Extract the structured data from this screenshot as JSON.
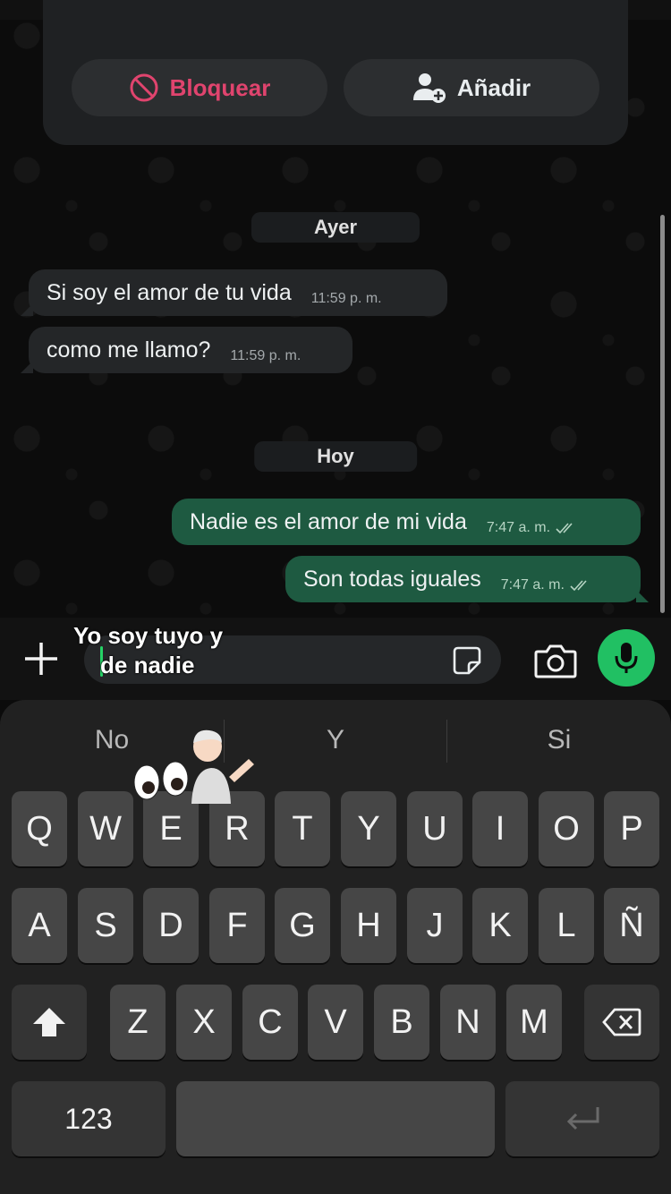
{
  "contact_card": {
    "block_label": "Bloquear",
    "add_label": "Añadir"
  },
  "chat": {
    "date_yesterday": "Ayer",
    "date_today": "Hoy",
    "messages": [
      {
        "direction": "incoming",
        "text": "Si soy el amor de tu vida",
        "time": "11:59 p. m."
      },
      {
        "direction": "incoming",
        "text": "como me llamo?",
        "time": "11:59 p. m."
      },
      {
        "direction": "outgoing",
        "text": "Nadie es el amor de mi vida",
        "time": "7:47 a. m.",
        "status": "read"
      },
      {
        "direction": "outgoing",
        "text": "Son todas iguales",
        "time": "7:47 a. m.",
        "status": "read"
      }
    ]
  },
  "composer": {
    "overlay_line1": "Yo soy tuyo y",
    "overlay_line2": "de nadie",
    "icons": [
      "plus-icon",
      "sticker-icon",
      "camera-icon",
      "mic-icon"
    ]
  },
  "keyboard": {
    "suggestions": [
      "No",
      "Y",
      "Si"
    ],
    "emoji_sticker": "👀🤷",
    "row1": [
      "Q",
      "W",
      "E",
      "R",
      "T",
      "Y",
      "U",
      "I",
      "O",
      "P"
    ],
    "row2": [
      "A",
      "S",
      "D",
      "F",
      "G",
      "H",
      "J",
      "K",
      "L",
      "Ñ"
    ],
    "row3": [
      "Z",
      "X",
      "C",
      "V",
      "B",
      "N",
      "M"
    ],
    "numbers_key": "123"
  },
  "colors": {
    "accent_green": "#21c063",
    "outgoing_bubble": "#1e5a41",
    "incoming_bubble": "#242628",
    "block_red": "#e0446e"
  }
}
